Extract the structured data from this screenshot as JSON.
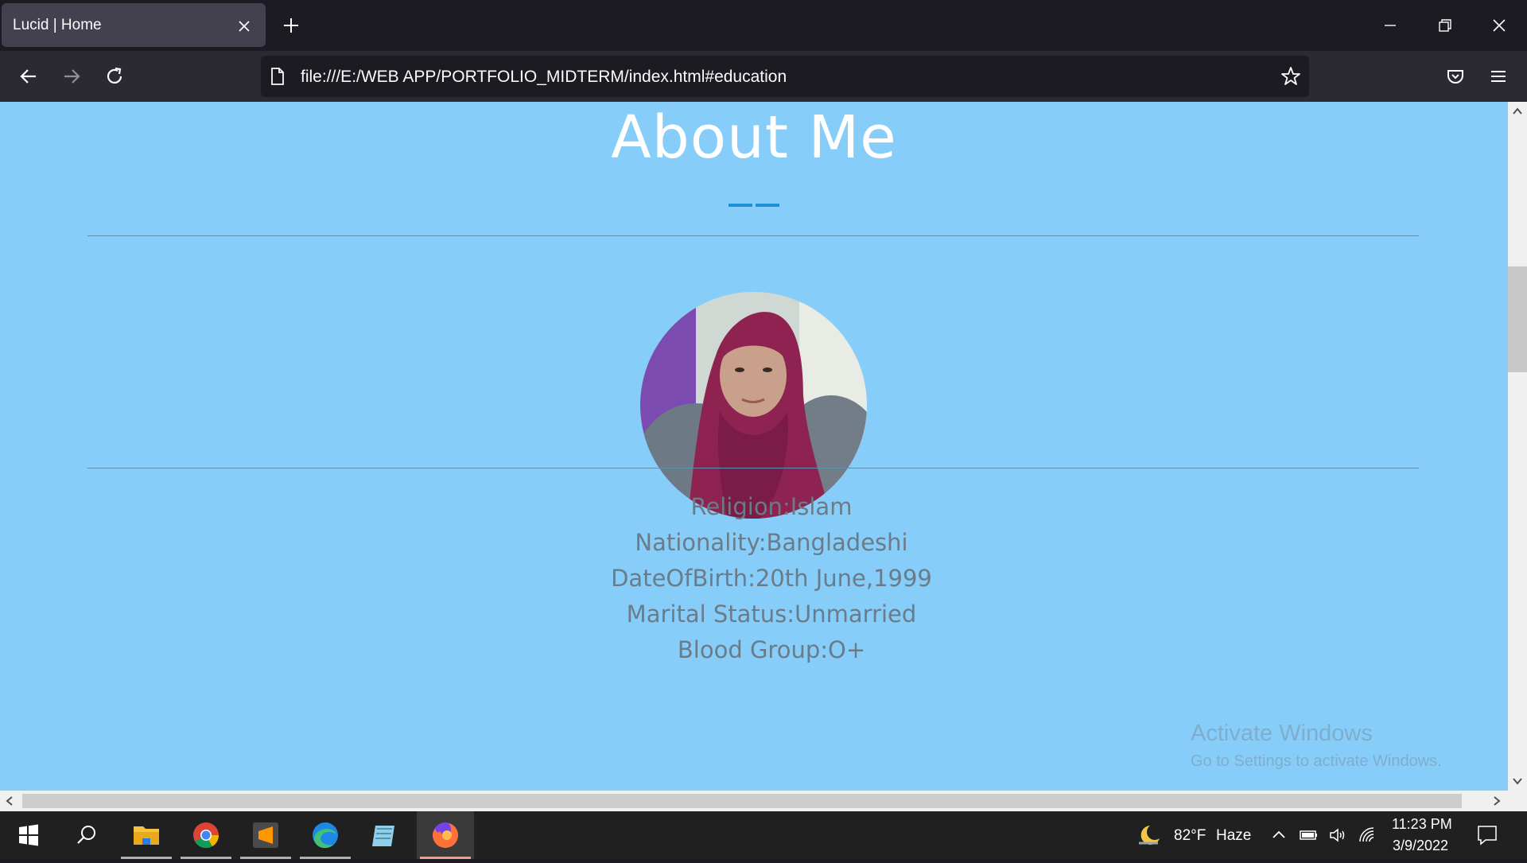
{
  "browser": {
    "tab_title": "Lucid | Home",
    "url": "file:///E:/WEB APP/PORTFOLIO_MIDTERM/index.html#education"
  },
  "page": {
    "title": "About Me",
    "accent_color": "#1e90d6",
    "background_color": "#87cdf9",
    "info": [
      "Religion:Islam",
      "Nationality:Bangladeshi",
      "DateOfBirth:20th June,1999",
      "Marital Status:Unmarried",
      "Blood Group:O+"
    ]
  },
  "watermark": {
    "line1": "Activate Windows",
    "line2": "Go to Settings to activate Windows."
  },
  "taskbar": {
    "apps": [
      "start-icon",
      "search-icon",
      "file-explorer-icon",
      "chrome-icon",
      "sublime-text-icon",
      "edge-icon",
      "notepad-icon",
      "firefox-icon"
    ],
    "weather_temp": "82°F",
    "weather_desc": "Haze",
    "time": "11:23 PM",
    "date": "3/9/2022"
  }
}
